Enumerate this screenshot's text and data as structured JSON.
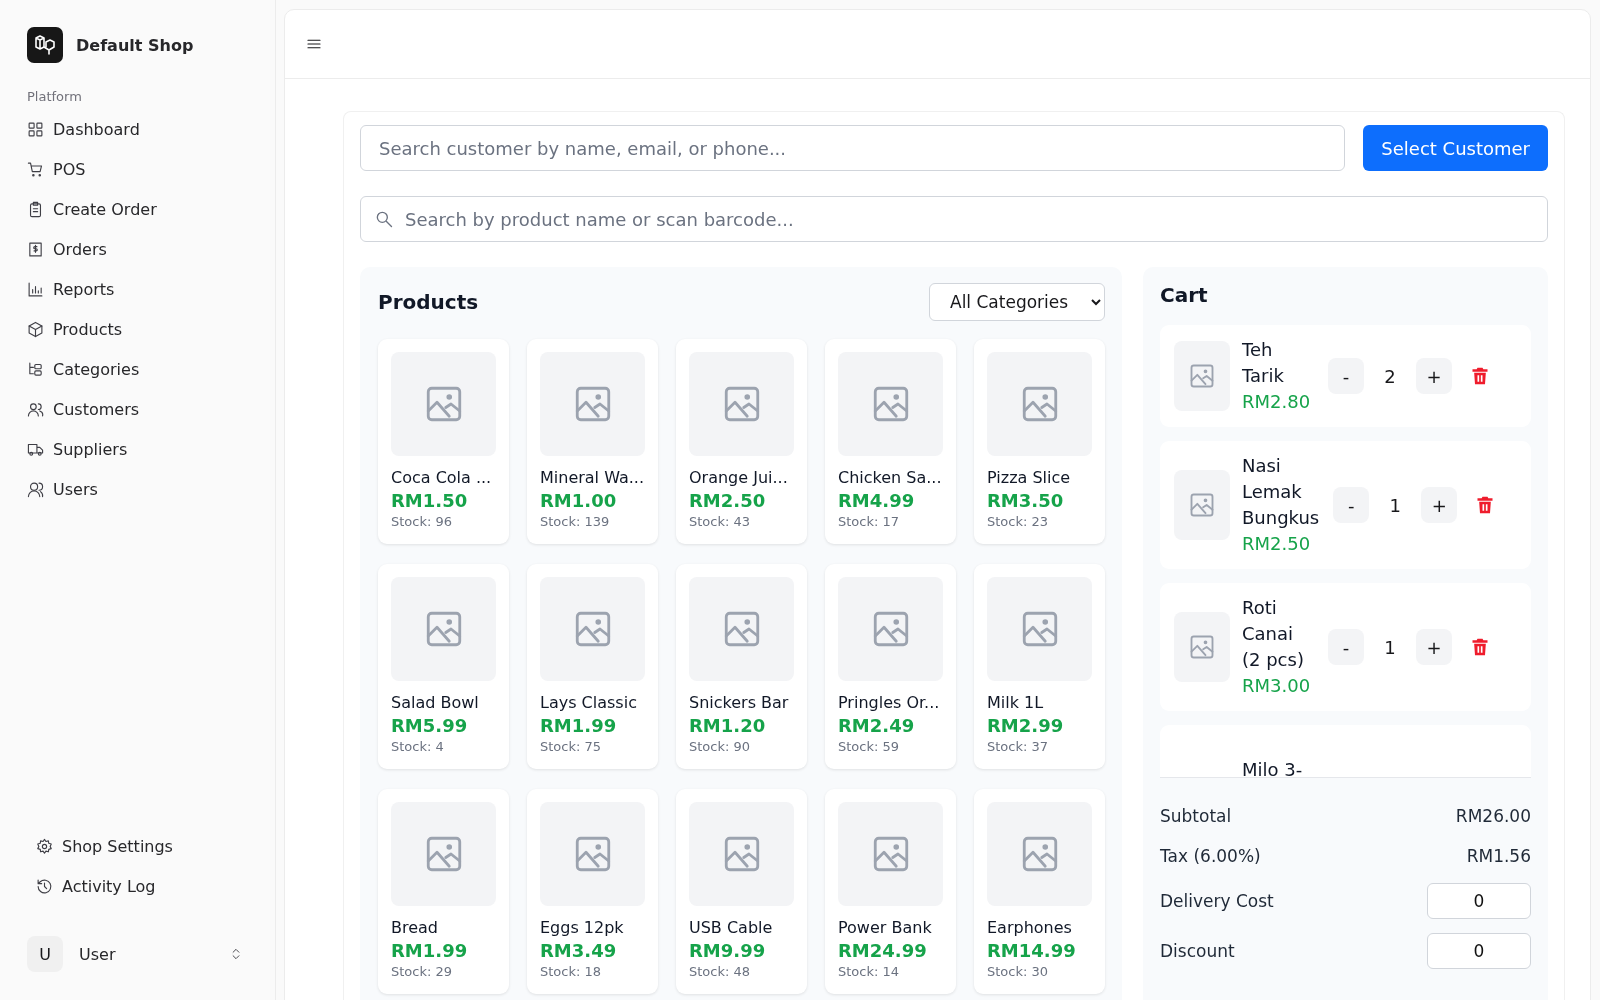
{
  "sidebar": {
    "shop_name": "Default Shop",
    "section_label": "Platform",
    "items": [
      {
        "label": "Dashboard"
      },
      {
        "label": "POS"
      },
      {
        "label": "Create Order"
      },
      {
        "label": "Orders"
      },
      {
        "label": "Reports"
      },
      {
        "label": "Products"
      },
      {
        "label": "Categories"
      },
      {
        "label": "Customers"
      },
      {
        "label": "Suppliers"
      },
      {
        "label": "Users"
      }
    ],
    "footer_items": [
      {
        "label": "Shop Settings"
      },
      {
        "label": "Activity Log"
      }
    ],
    "user": {
      "initial": "U",
      "name": "User"
    }
  },
  "customer_search": {
    "placeholder": "Search customer by name, email, or phone...",
    "button": "Select Customer"
  },
  "product_search": {
    "placeholder": "Search by product name or scan barcode..."
  },
  "products": {
    "title": "Products",
    "category_filter": "All Categories",
    "items": [
      {
        "name": "Coca Cola ...",
        "price": "RM1.50",
        "stock": "Stock: 96"
      },
      {
        "name": "Mineral Wa...",
        "price": "RM1.00",
        "stock": "Stock: 139"
      },
      {
        "name": "Orange Jui...",
        "price": "RM2.50",
        "stock": "Stock: 43"
      },
      {
        "name": "Chicken Sa...",
        "price": "RM4.99",
        "stock": "Stock: 17"
      },
      {
        "name": "Pizza Slice",
        "price": "RM3.50",
        "stock": "Stock: 23"
      },
      {
        "name": "Salad Bowl",
        "price": "RM5.99",
        "stock": "Stock: 4"
      },
      {
        "name": "Lays Classic",
        "price": "RM1.99",
        "stock": "Stock: 75"
      },
      {
        "name": "Snickers Bar",
        "price": "RM1.20",
        "stock": "Stock: 90"
      },
      {
        "name": "Pringles Or...",
        "price": "RM2.49",
        "stock": "Stock: 59"
      },
      {
        "name": "Milk 1L",
        "price": "RM2.99",
        "stock": "Stock: 37"
      },
      {
        "name": "Bread",
        "price": "RM1.99",
        "stock": "Stock: 29"
      },
      {
        "name": "Eggs 12pk",
        "price": "RM3.49",
        "stock": "Stock: 18"
      },
      {
        "name": "USB Cable",
        "price": "RM9.99",
        "stock": "Stock: 48"
      },
      {
        "name": "Power Bank",
        "price": "RM24.99",
        "stock": "Stock: 14"
      },
      {
        "name": "Earphones",
        "price": "RM14.99",
        "stock": "Stock: 30"
      }
    ]
  },
  "cart": {
    "title": "Cart",
    "items": [
      {
        "name": "Teh Tarik",
        "price": "RM2.80",
        "quantity": "2",
        "decrement": "-",
        "increment": "+"
      },
      {
        "name": "Nasi Lemak Bungkus",
        "price": "RM2.50",
        "quantity": "1",
        "decrement": "-",
        "increment": "+"
      },
      {
        "name": "Roti Canai (2 pcs)",
        "price": "RM3.00",
        "quantity": "1",
        "decrement": "-",
        "increment": "+"
      },
      {
        "name": "Milo 3-"
      }
    ],
    "summary": [
      {
        "kind": "text",
        "label": "Subtotal",
        "value": "RM26.00"
      },
      {
        "kind": "text",
        "label": "Tax (6.00%)",
        "value": "RM1.56"
      },
      {
        "kind": "input",
        "label": "Delivery Cost",
        "value": "0"
      },
      {
        "kind": "input",
        "label": "Discount",
        "value": "0"
      }
    ]
  }
}
